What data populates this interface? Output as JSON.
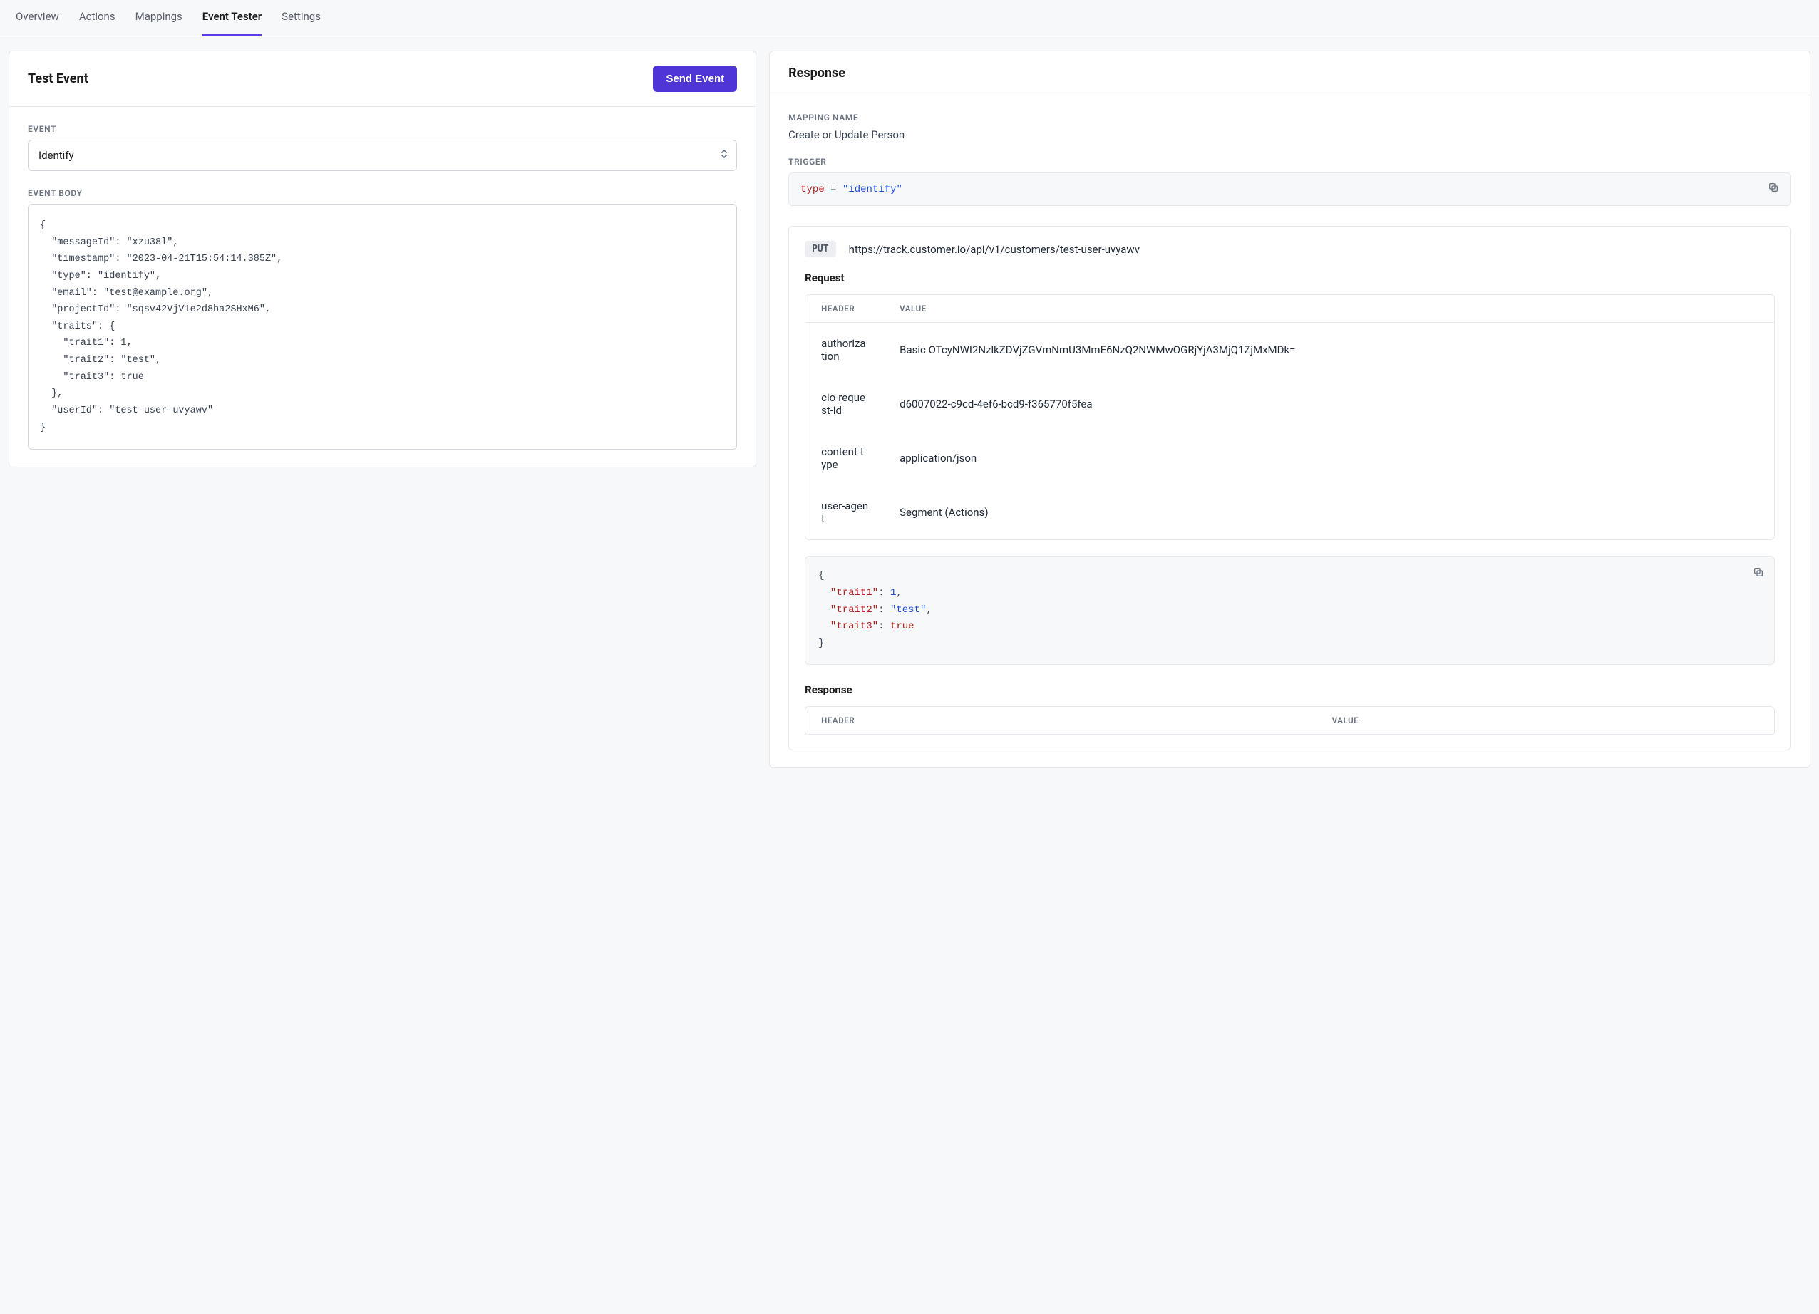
{
  "tabs": [
    "Overview",
    "Actions",
    "Mappings",
    "Event Tester",
    "Settings"
  ],
  "activeTab": "Event Tester",
  "left": {
    "title": "Test Event",
    "button": "Send Event",
    "eventLabel": "EVENT",
    "eventSelected": "Identify",
    "bodyLabel": "EVENT BODY",
    "bodyText": "{\n  \"messageId\": \"xzu38l\",\n  \"timestamp\": \"2023-04-21T15:54:14.385Z\",\n  \"type\": \"identify\",\n  \"email\": \"test@example.org\",\n  \"projectId\": \"sqsv42VjV1e2d8ha2SHxM6\",\n  \"traits\": {\n    \"trait1\": 1,\n    \"trait2\": \"test\",\n    \"trait3\": true\n  },\n  \"userId\": \"test-user-uvyawv\"\n}"
  },
  "right": {
    "title": "Response",
    "mappingLabel": "MAPPING NAME",
    "mappingValue": "Create or Update Person",
    "triggerLabel": "TRIGGER",
    "trigger": {
      "lhs": "type",
      "op": "=",
      "rhs": "\"identify\""
    },
    "method": "PUT",
    "url": "https://track.customer.io/api/v1/customers/test-user-uvyawv",
    "requestTitle": "Request",
    "headerCol": "HEADER",
    "valueCol": "VALUE",
    "requestHeaders": [
      {
        "h": "authorization",
        "v": "Basic OTcyNWI2NzlkZDVjZGVmNmU3MmE6NzQ2NWMwOGRjYjA3MjQ1ZjMxMDk="
      },
      {
        "h": "cio-request-id",
        "v": "d6007022-c9cd-4ef6-bcd9-f365770f5fea"
      },
      {
        "h": "content-type",
        "v": "application/json"
      },
      {
        "h": "user-agent",
        "v": "Segment (Actions)"
      }
    ],
    "requestBody": [
      {
        "k": "\"trait1\"",
        "v": "1",
        "t": "n"
      },
      {
        "k": "\"trait2\"",
        "v": "\"test\"",
        "t": "s"
      },
      {
        "k": "\"trait3\"",
        "v": "true",
        "t": "b"
      }
    ],
    "responseTitle": "Response"
  }
}
